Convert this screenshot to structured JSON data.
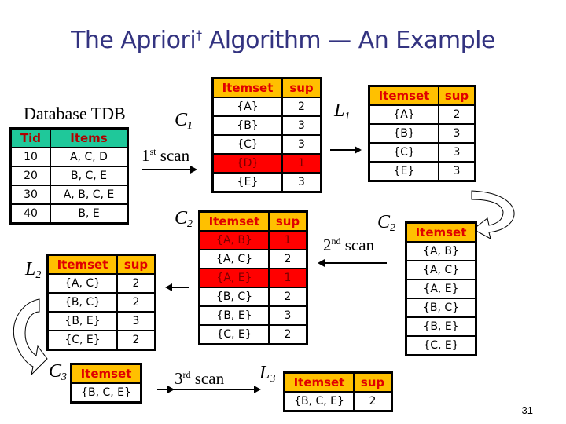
{
  "title": {
    "main": "The Apriori",
    "dagger": "†",
    "rest": " Algorithm — An Example"
  },
  "labels": {
    "database": "Database TDB",
    "c1": "C",
    "c1_sub": "1",
    "l1": "L",
    "l1_sub": "1",
    "c2_left": "C",
    "c2_left_sub": "2",
    "c2_right": "C",
    "c2_right_sub": "2",
    "l2": "L",
    "l2_sub": "2",
    "c3": "C",
    "c3_sub": "3",
    "l3": "L",
    "l3_sub": "3",
    "scan1_num": "1",
    "scan1_sup": "st",
    "scan1_word": " scan",
    "scan2_num": "2",
    "scan2_sup": "nd",
    "scan2_word": " scan",
    "scan3_num": "3",
    "scan3_sup": "rd",
    "scan3_word": " scan"
  },
  "tdb": {
    "headers": [
      "Tid",
      "Items"
    ],
    "rows": [
      [
        "10",
        "A, C, D"
      ],
      [
        "20",
        "B, C, E"
      ],
      [
        "30",
        "A, B, C, E"
      ],
      [
        "40",
        "B, E"
      ]
    ]
  },
  "c1": {
    "headers": [
      "Itemset",
      "sup"
    ],
    "rows": [
      [
        "{A}",
        "2"
      ],
      [
        "{B}",
        "3"
      ],
      [
        "{C}",
        "3"
      ],
      [
        "{D}",
        "1"
      ],
      [
        "{E}",
        "3"
      ]
    ],
    "pruned": [
      3
    ]
  },
  "l1": {
    "headers": [
      "Itemset",
      "sup"
    ],
    "rows": [
      [
        "{A}",
        "2"
      ],
      [
        "{B}",
        "3"
      ],
      [
        "{C}",
        "3"
      ],
      [
        "{E}",
        "3"
      ]
    ]
  },
  "c2_counted": {
    "headers": [
      "Itemset",
      "sup"
    ],
    "rows": [
      [
        "{A, B}",
        "1"
      ],
      [
        "{A, C}",
        "2"
      ],
      [
        "{A, E}",
        "1"
      ],
      [
        "{B, C}",
        "2"
      ],
      [
        "{B, E}",
        "3"
      ],
      [
        "{C, E}",
        "2"
      ]
    ],
    "pruned": [
      0,
      2
    ]
  },
  "c2_candidates": {
    "headers": [
      "Itemset"
    ],
    "rows": [
      [
        "{A, B}"
      ],
      [
        "{A, C}"
      ],
      [
        "{A, E}"
      ],
      [
        "{B, C}"
      ],
      [
        "{B, E}"
      ],
      [
        "{C, E}"
      ]
    ]
  },
  "l2": {
    "headers": [
      "Itemset",
      "sup"
    ],
    "rows": [
      [
        "{A, C}",
        "2"
      ],
      [
        "{B, C}",
        "2"
      ],
      [
        "{B, E}",
        "3"
      ],
      [
        "{C, E}",
        "2"
      ]
    ]
  },
  "c3": {
    "headers": [
      "Itemset"
    ],
    "rows": [
      [
        "{B, C, E}"
      ]
    ]
  },
  "l3": {
    "headers": [
      "Itemset",
      "sup"
    ],
    "rows": [
      [
        "{B, C, E}",
        "2"
      ]
    ]
  },
  "page_number": "31"
}
